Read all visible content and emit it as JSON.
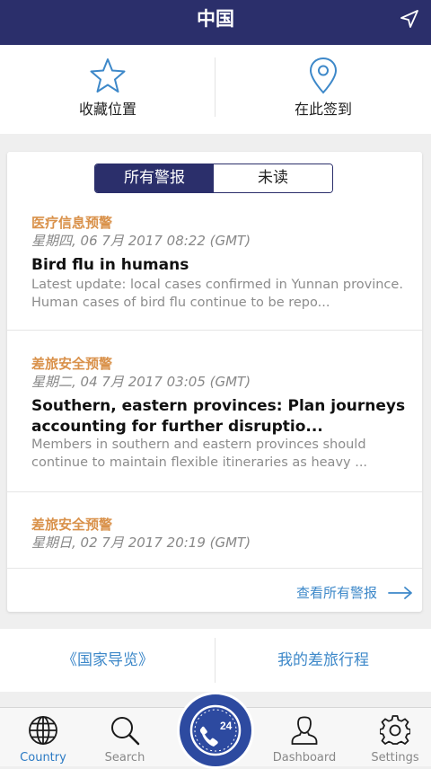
{
  "header": {
    "title": "中国"
  },
  "actions": {
    "favorite_label": "收藏位置",
    "checkin_label": "在此签到"
  },
  "segment": {
    "all_label": "所有警报",
    "unread_label": "未读"
  },
  "alerts": [
    {
      "category": "医疗信息预警",
      "date": "星期四, 06 7月 2017 08:22 (GMT)",
      "title": "Bird flu in humans",
      "desc1": "Latest update: local cases confirmed in Yunnan province.",
      "desc2": "Human cases of bird flu continue to be repo..."
    },
    {
      "category": "差旅安全预警",
      "date": "星期二, 04 7月 2017 03:05 (GMT)",
      "title1": "Southern, eastern provinces: Plan journeys",
      "title2": "accounting for further disruptio...",
      "desc1": "Members in southern and eastern provinces should",
      "desc2": "continue to maintain flexible itineraries as heavy ..."
    },
    {
      "category": "差旅安全预警",
      "date": "星期日, 02 7月 2017 20:19 (GMT)"
    }
  ],
  "see_all_label": "查看所有警报",
  "guide": {
    "country_guide": "《国家导览》",
    "my_trips": "我的差旅行程"
  },
  "tabs": {
    "country": "Country",
    "search": "Search",
    "dashboard": "Dashboard",
    "settings": "Settings",
    "center_badge": "24"
  },
  "colors": {
    "brand": "#2b2f6b",
    "accent": "#3d88c9",
    "alert_category": "#d9914a",
    "fab": "#2d4aa0"
  },
  "icons": [
    "navigation-arrow-icon",
    "star-icon",
    "location-pin-icon",
    "arrow-right-icon",
    "globe-icon",
    "search-icon",
    "phone-24-icon",
    "user-icon",
    "gear-icon"
  ]
}
